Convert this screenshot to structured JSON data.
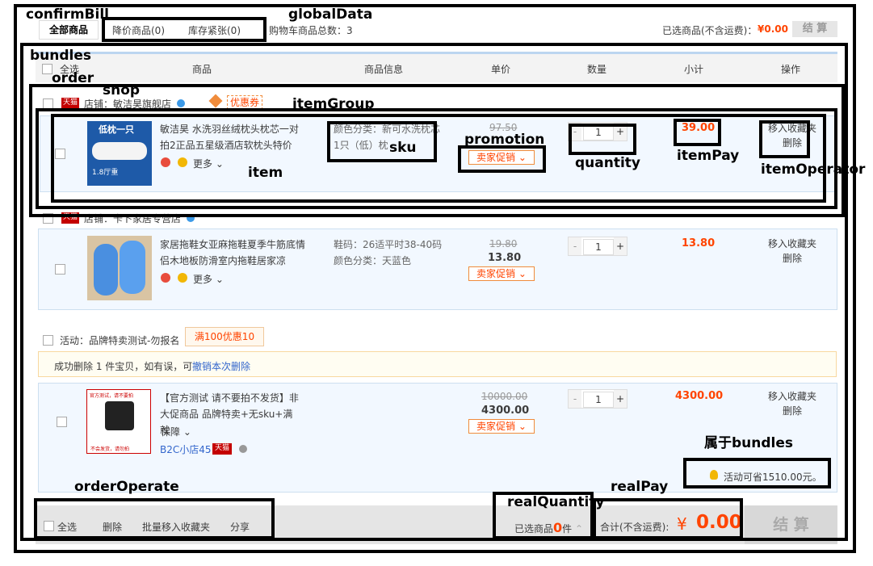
{
  "annotations": {
    "confirmBill": "confirmBill",
    "globalData": "globalData",
    "bundles": "bundles",
    "order": "order",
    "shop": "shop",
    "itemGroup": "itemGroup",
    "promotion": "promotion",
    "sku": "sku",
    "quantity": "quantity",
    "itemPay": "itemPay",
    "itemOperator": "itemOperator",
    "item": "item",
    "bundles_note": "属于bundles",
    "orderOperate": "orderOperate",
    "realQuantity": "realQuantity",
    "realPay": "realPay"
  },
  "top": {
    "all_items_btn": "全部商品",
    "price_drop": "降价商品(0)",
    "low_stock": "库存紧张(0)",
    "cart_total": "购物车商品总数：3",
    "selected_label": "已选商品(不含运费)：",
    "selected_amount": "¥0.00",
    "settle_btn": "结 算"
  },
  "table_header": {
    "select_all": "全选",
    "product": "商品",
    "product_info": "商品信息",
    "unit_price": "单价",
    "quantity": "数量",
    "subtotal": "小计",
    "operate": "操作"
  },
  "shop1": {
    "badge": "天猫",
    "name": "店铺：敏洁昊旗舰店",
    "coupon": "优惠券"
  },
  "item1": {
    "thumb_text1": "低枕一只",
    "thumb_text2": "1.8厅重",
    "title": "敏洁昊 水洗羽丝绒枕头枕芯一对拍2正品五星级酒店软枕头特价",
    "more": "更多",
    "sku": "颜色分类：新可水洗枕芯1只（低）枕",
    "orig_price": "97.50",
    "promo": "卖家促销",
    "qty": "1",
    "pay": "39.00",
    "op1": "移入收藏夹",
    "op2": "删除"
  },
  "shop2": {
    "badge": "天猫",
    "name": "店铺：卡卜家居专营店"
  },
  "item2": {
    "title": "家居拖鞋女亚麻拖鞋夏季牛筋底情侣木地板防滑室内拖鞋居家凉",
    "more": "更多",
    "sku1": "鞋码：26适平时38-40码",
    "sku2": "颜色分类：天蓝色",
    "orig_price": "19.80",
    "price": "13.80",
    "promo": "卖家促销",
    "qty": "1",
    "pay": "13.80",
    "op1": "移入收藏夹",
    "op2": "删除"
  },
  "activity": {
    "label": "活动：品牌特卖测试-勿报名",
    "tag": "满100优惠10"
  },
  "notice": {
    "text": "成功删除 1 件宝贝，如有误，可",
    "link": "撤销本次删除"
  },
  "item3": {
    "thumb_text": "官方测试，请不要拍",
    "thumb_text2": "不会发货，请勿拍",
    "title": "【官方测试 请不要拍不发货】非大促商品 品牌特卖+无sku+满就",
    "guarantee": "保障",
    "shop": "B2C小店45",
    "badge": "天猫",
    "orig_price": "10000.00",
    "price": "4300.00",
    "promo": "卖家促销",
    "qty": "1",
    "pay": "4300.00",
    "op1": "移入收藏夹",
    "op2": "删除",
    "save_note": "活动可省1510.00元。"
  },
  "footer": {
    "select_all": "全选",
    "delete": "删除",
    "batch_fav": "批量移入收藏夹",
    "share": "分享",
    "selected_prefix": "已选商品",
    "selected_count": "0",
    "selected_suffix": "件",
    "total_label": "合计(不含运费):",
    "currency": "¥",
    "total": "0.00",
    "settle": "结 算"
  }
}
